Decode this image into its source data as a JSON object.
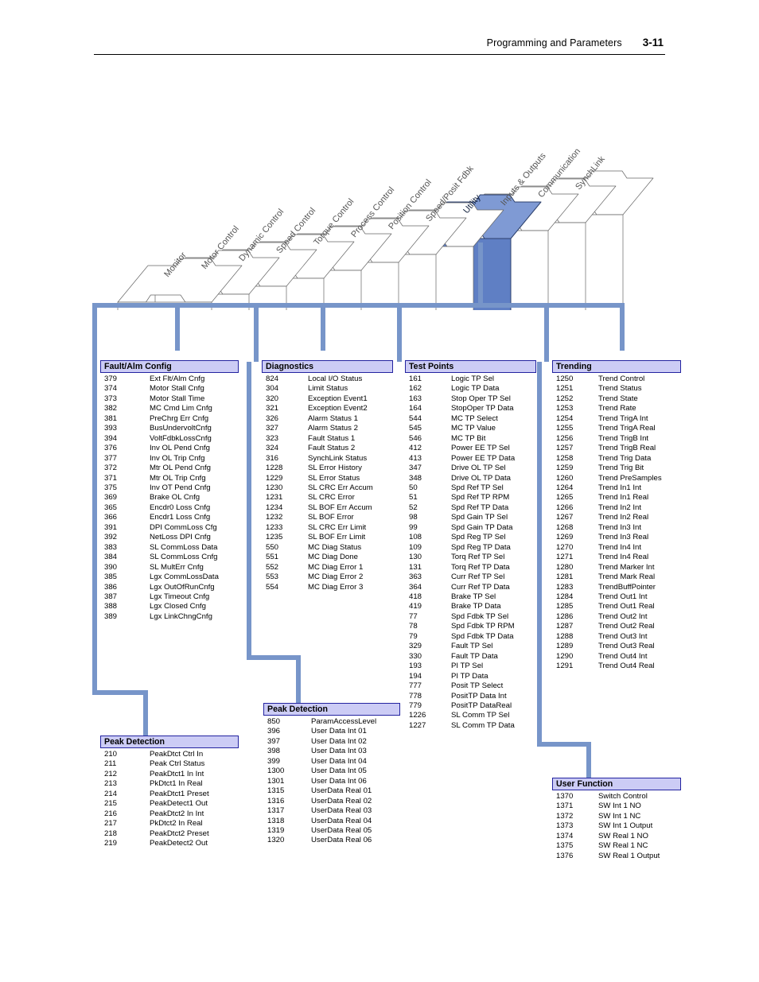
{
  "header": {
    "title": "Programming and Parameters",
    "page_number": "3-11"
  },
  "colors": {
    "connector": "#7795c9",
    "group_header_fill": "#ccccf5",
    "group_header_border": "#2323a0",
    "active_tab_fill": "#7f9ad4",
    "active_tab_front": "#5f7fc4",
    "folder_outline": "#666666"
  },
  "folder_stack": {
    "active_tab": "Utility",
    "tabs": [
      {
        "label": "Monitor",
        "active": false
      },
      {
        "label": "Motor Control",
        "active": false
      },
      {
        "label": "Dynamic Control",
        "active": false
      },
      {
        "label": "Speed Control",
        "active": false
      },
      {
        "label": "Torque Control",
        "active": false
      },
      {
        "label": "Process Control",
        "active": false
      },
      {
        "label": "Position Control",
        "active": false
      },
      {
        "label": "Speed/Posit Fdbk",
        "active": false
      },
      {
        "label": "Utility",
        "active": true
      },
      {
        "label": "Inputs & Outputs",
        "active": false
      },
      {
        "label": "Communication",
        "active": false
      },
      {
        "label": "SynchLink",
        "active": false
      }
    ]
  },
  "groups": [
    {
      "id": "fault-alm-config",
      "title": "Fault/Alm Config",
      "rows": [
        {
          "num": "379",
          "name": "Ext Flt/Alm Cnfg"
        },
        {
          "num": "374",
          "name": "Motor Stall Cnfg"
        },
        {
          "num": "373",
          "name": "Motor Stall Time"
        },
        {
          "num": "382",
          "name": "MC Cmd Lim Cnfg"
        },
        {
          "num": "381",
          "name": "PreChrg Err Cnfg"
        },
        {
          "num": "393",
          "name": "BusUndervoltCnfg"
        },
        {
          "num": "394",
          "name": "VoltFdbkLossCnfg"
        },
        {
          "num": "376",
          "name": "Inv OL Pend Cnfg"
        },
        {
          "num": "377",
          "name": "Inv OL Trip Cnfg"
        },
        {
          "num": "372",
          "name": "Mtr OL Pend Cnfg"
        },
        {
          "num": "371",
          "name": "Mtr OL Trip Cnfg"
        },
        {
          "num": "375",
          "name": "Inv OT Pend Cnfg"
        },
        {
          "num": "369",
          "name": "Brake OL Cnfg"
        },
        {
          "num": "365",
          "name": "Encdr0 Loss Cnfg"
        },
        {
          "num": "366",
          "name": "Encdr1 Loss Cnfg"
        },
        {
          "num": "391",
          "name": "DPI CommLoss Cfg"
        },
        {
          "num": "392",
          "name": "NetLoss DPI Cnfg"
        },
        {
          "num": "383",
          "name": "SL CommLoss Data"
        },
        {
          "num": "384",
          "name": "SL CommLoss Cnfg"
        },
        {
          "num": "390",
          "name": "SL MultErr Cnfg"
        },
        {
          "num": "385",
          "name": "Lgx CommLossData"
        },
        {
          "num": "386",
          "name": "Lgx OutOfRunCnfg"
        },
        {
          "num": "387",
          "name": "Lgx Timeout Cnfg"
        },
        {
          "num": "388",
          "name": "Lgx Closed Cnfg"
        },
        {
          "num": "389",
          "name": "Lgx LinkChngCnfg"
        }
      ]
    },
    {
      "id": "diagnostics",
      "title": "Diagnostics",
      "rows": [
        {
          "num": "824",
          "name": "Local I/O Status"
        },
        {
          "num": "304",
          "name": "Limit Status"
        },
        {
          "num": "320",
          "name": "Exception Event1"
        },
        {
          "num": "321",
          "name": "Exception Event2"
        },
        {
          "num": "326",
          "name": "Alarm Status 1"
        },
        {
          "num": "327",
          "name": "Alarm Status 2"
        },
        {
          "num": "323",
          "name": "Fault Status 1"
        },
        {
          "num": "324",
          "name": "Fault Status 2"
        },
        {
          "num": "316",
          "name": "SynchLink Status"
        },
        {
          "num": "1228",
          "name": "SL Error History"
        },
        {
          "num": "1229",
          "name": "SL Error Status"
        },
        {
          "num": "1230",
          "name": "SL CRC Err Accum"
        },
        {
          "num": "1231",
          "name": "SL CRC Error"
        },
        {
          "num": "1234",
          "name": "SL BOF Err Accum"
        },
        {
          "num": "1232",
          "name": "SL BOF Error"
        },
        {
          "num": "1233",
          "name": "SL CRC Err Limit"
        },
        {
          "num": "1235",
          "name": "SL BOF Err Limit"
        },
        {
          "num": "550",
          "name": "MC Diag Status"
        },
        {
          "num": "551",
          "name": "MC Diag Done"
        },
        {
          "num": "552",
          "name": "MC Diag Error 1"
        },
        {
          "num": "553",
          "name": "MC Diag Error 2"
        },
        {
          "num": "554",
          "name": "MC Diag Error 3"
        }
      ]
    },
    {
      "id": "test-points",
      "title": "Test Points",
      "rows": [
        {
          "num": "161",
          "name": "Logic TP Sel"
        },
        {
          "num": "162",
          "name": "Logic TP Data"
        },
        {
          "num": "163",
          "name": "Stop Oper TP Sel"
        },
        {
          "num": "164",
          "name": "StopOper TP Data"
        },
        {
          "num": "544",
          "name": "MC TP Select"
        },
        {
          "num": "545",
          "name": "MC TP Value"
        },
        {
          "num": "546",
          "name": "MC TP Bit"
        },
        {
          "num": "412",
          "name": "Power EE TP Sel"
        },
        {
          "num": "413",
          "name": "Power EE TP Data"
        },
        {
          "num": "347",
          "name": "Drive OL TP Sel"
        },
        {
          "num": "348",
          "name": "Drive OL TP Data"
        },
        {
          "num": "50",
          "name": "Spd Ref TP Sel"
        },
        {
          "num": "51",
          "name": "Spd Ref TP RPM"
        },
        {
          "num": "52",
          "name": "Spd Ref TP Data"
        },
        {
          "num": "98",
          "name": "Spd Gain TP Sel"
        },
        {
          "num": "99",
          "name": "Spd Gain TP Data"
        },
        {
          "num": "108",
          "name": "Spd Reg TP Sel"
        },
        {
          "num": "109",
          "name": "Spd Reg TP Data"
        },
        {
          "num": "130",
          "name": "Torq Ref TP Sel"
        },
        {
          "num": "131",
          "name": "Torq Ref TP Data"
        },
        {
          "num": "363",
          "name": "Curr Ref TP Sel"
        },
        {
          "num": "364",
          "name": "Curr Ref TP Data"
        },
        {
          "num": "418",
          "name": "Brake TP Sel"
        },
        {
          "num": "419",
          "name": "Brake TP Data"
        },
        {
          "num": "77",
          "name": "Spd Fdbk TP Sel"
        },
        {
          "num": "78",
          "name": "Spd Fdbk TP RPM"
        },
        {
          "num": "79",
          "name": "Spd Fdbk TP Data"
        },
        {
          "num": "329",
          "name": "Fault TP Sel"
        },
        {
          "num": "330",
          "name": "Fault TP Data"
        },
        {
          "num": "193",
          "name": "PI TP Sel"
        },
        {
          "num": "194",
          "name": "PI TP Data"
        },
        {
          "num": "777",
          "name": "Posit TP Select"
        },
        {
          "num": "778",
          "name": "PositTP Data Int"
        },
        {
          "num": "779",
          "name": "PositTP DataReal"
        },
        {
          "num": "1226",
          "name": "SL Comm TP Sel"
        },
        {
          "num": "1227",
          "name": "SL Comm TP Data"
        }
      ]
    },
    {
      "id": "trending",
      "title": "Trending",
      "rows": [
        {
          "num": "1250",
          "name": "Trend Control"
        },
        {
          "num": "1251",
          "name": "Trend Status"
        },
        {
          "num": "1252",
          "name": "Trend State"
        },
        {
          "num": "1253",
          "name": "Trend Rate"
        },
        {
          "num": "1254",
          "name": "Trend TrigA Int"
        },
        {
          "num": "1255",
          "name": "Trend TrigA Real"
        },
        {
          "num": "1256",
          "name": "Trend TrigB Int"
        },
        {
          "num": "1257",
          "name": "Trend TrigB Real"
        },
        {
          "num": "1258",
          "name": "Trend Trig Data"
        },
        {
          "num": "1259",
          "name": "Trend Trig Bit"
        },
        {
          "num": "1260",
          "name": "Trend PreSamples"
        },
        {
          "num": "1264",
          "name": "Trend In1 Int"
        },
        {
          "num": "1265",
          "name": "Trend In1 Real"
        },
        {
          "num": "1266",
          "name": "Trend In2 Int"
        },
        {
          "num": "1267",
          "name": "Trend In2 Real"
        },
        {
          "num": "1268",
          "name": "Trend In3 Int"
        },
        {
          "num": "1269",
          "name": "Trend In3 Real"
        },
        {
          "num": "1270",
          "name": "Trend In4 Int"
        },
        {
          "num": "1271",
          "name": "Trend In4 Real"
        },
        {
          "num": "1280",
          "name": "Trend Marker Int"
        },
        {
          "num": "1281",
          "name": "Trend Mark Real"
        },
        {
          "num": "1283",
          "name": "TrendBuffPointer"
        },
        {
          "num": "1284",
          "name": "Trend Out1 Int"
        },
        {
          "num": "1285",
          "name": "Trend Out1 Real"
        },
        {
          "num": "1286",
          "name": "Trend Out2 Int"
        },
        {
          "num": "1287",
          "name": "Trend Out2 Real"
        },
        {
          "num": "1288",
          "name": "Trend Out3 Int"
        },
        {
          "num": "1289",
          "name": "Trend Out3 Real"
        },
        {
          "num": "1290",
          "name": "Trend Out4 Int"
        },
        {
          "num": "1291",
          "name": "Trend Out4 Real"
        }
      ]
    },
    {
      "id": "peak-detection-1",
      "title": "Peak Detection",
      "rows": [
        {
          "num": "210",
          "name": "PeakDtct Ctrl In"
        },
        {
          "num": "211",
          "name": "Peak Ctrl Status"
        },
        {
          "num": "212",
          "name": "PeakDtct1 In Int"
        },
        {
          "num": "213",
          "name": "PkDtct1 In Real"
        },
        {
          "num": "214",
          "name": "PeakDtct1 Preset"
        },
        {
          "num": "215",
          "name": "PeakDetect1 Out"
        },
        {
          "num": "216",
          "name": "PeakDtct2 In Int"
        },
        {
          "num": "217",
          "name": "PkDtct2 In Real"
        },
        {
          "num": "218",
          "name": "PeakDtct2 Preset"
        },
        {
          "num": "219",
          "name": "PeakDetect2 Out"
        }
      ]
    },
    {
      "id": "peak-detection-2",
      "title": "Peak Detection",
      "rows": [
        {
          "num": "850",
          "name": "ParamAccessLevel"
        },
        {
          "num": "396",
          "name": "User Data Int 01"
        },
        {
          "num": "397",
          "name": "User Data Int 02"
        },
        {
          "num": "398",
          "name": "User Data Int 03"
        },
        {
          "num": "399",
          "name": "User Data Int 04"
        },
        {
          "num": "1300",
          "name": "User Data Int 05"
        },
        {
          "num": "1301",
          "name": "User Data Int 06"
        },
        {
          "num": "1315",
          "name": "UserData Real 01"
        },
        {
          "num": "1316",
          "name": "UserData Real 02"
        },
        {
          "num": "1317",
          "name": "UserData Real 03"
        },
        {
          "num": "1318",
          "name": "UserData Real 04"
        },
        {
          "num": "1319",
          "name": "UserData Real 05"
        },
        {
          "num": "1320",
          "name": "UserData Real 06"
        }
      ]
    },
    {
      "id": "user-function",
      "title": "User Function",
      "rows": [
        {
          "num": "1370",
          "name": "Switch Control"
        },
        {
          "num": "1371",
          "name": "SW Int 1 NO"
        },
        {
          "num": "1372",
          "name": "SW Int 1 NC"
        },
        {
          "num": "1373",
          "name": "SW Int 1 Output"
        },
        {
          "num": "1374",
          "name": "SW Real 1 NO"
        },
        {
          "num": "1375",
          "name": "SW Real 1 NC"
        },
        {
          "num": "1376",
          "name": "SW Real 1 Output"
        }
      ]
    }
  ]
}
